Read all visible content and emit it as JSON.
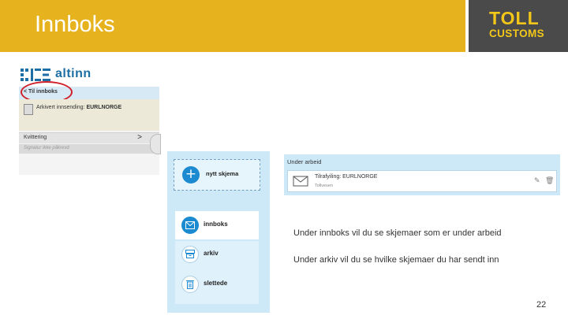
{
  "slide": {
    "title": "Innboks",
    "page_number": "22",
    "bullets": [
      "Under innboks vil du se skjemaer som er under arbeid",
      "Under arkiv vil du se hvilke skjemaer du har sendt inn"
    ]
  },
  "logo": {
    "line1": "TOLL",
    "line2": "CUSTOMS"
  },
  "colors": {
    "title_bar": "#e6b31e",
    "logo_bg": "#4a4a4a",
    "logo_text": "#f2c71a",
    "altinn_blue": "#1c8ad0",
    "highlight_ring": "#d0202a"
  },
  "altinn": {
    "brand": "altinn",
    "back_link": "< Til innboks",
    "doc_prefix": "Arkivert innsending:",
    "doc_name": "EURLNORGE",
    "kvittering": "Kvittering",
    "kvittering_chevron": ">",
    "signature_note": "Signatur ikke påkrevd"
  },
  "sidebar": {
    "new_form_label": "nytt skjema",
    "new_form_icon": "plus-icon",
    "items": [
      {
        "label": "innboks",
        "icon": "envelope-icon",
        "selected": true
      },
      {
        "label": "arkiv",
        "icon": "archive-icon",
        "selected": false
      },
      {
        "label": "slettede",
        "icon": "trash-icon",
        "selected": false
      }
    ]
  },
  "under_arbeid": {
    "title": "Under arbeid",
    "item_name": "Tilrafyiling: EURLNORGE",
    "item_sub": "Tollvesen",
    "icons": [
      "envelope-icon",
      "edit-icon",
      "trash-icon"
    ]
  }
}
